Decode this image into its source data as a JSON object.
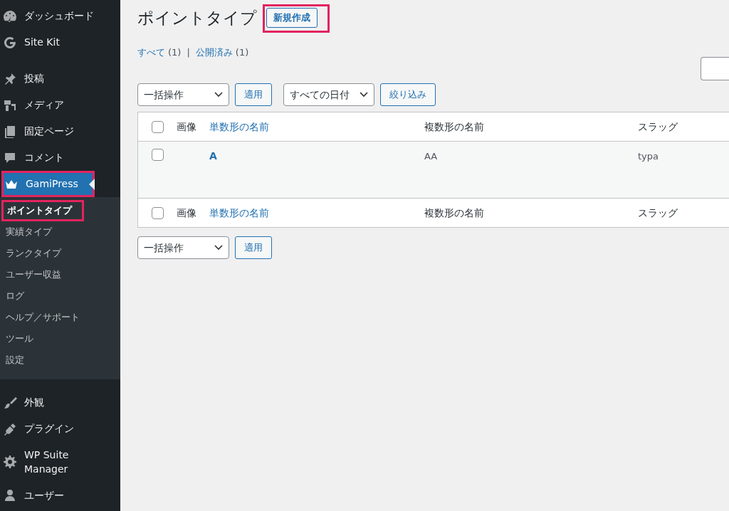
{
  "sidebar": {
    "groups": [
      [
        {
          "label": "ダッシュボード",
          "selected": false,
          "annotated": false
        },
        {
          "label": "Site Kit",
          "selected": false,
          "annotated": false
        }
      ],
      [
        {
          "label": "投稿",
          "selected": false,
          "annotated": false
        },
        {
          "label": "メディア",
          "selected": false,
          "annotated": false
        },
        {
          "label": "固定ページ",
          "selected": false,
          "annotated": false
        },
        {
          "label": "コメント",
          "selected": false,
          "annotated": false
        },
        {
          "label": "GamiPress",
          "selected": true,
          "annotated": true,
          "children": [
            {
              "label": "ポイントタイプ",
              "selected": true,
              "annotated": true
            },
            {
              "label": "実績タイプ",
              "selected": false,
              "annotated": false
            },
            {
              "label": "ランクタイプ",
              "selected": false,
              "annotated": false
            },
            {
              "label": "ユーザー収益",
              "selected": false,
              "annotated": false
            },
            {
              "label": "ログ",
              "selected": false,
              "annotated": false
            },
            {
              "label": "ヘルプ／サポート",
              "selected": false,
              "annotated": false
            },
            {
              "label": "ツール",
              "selected": false,
              "annotated": false
            },
            {
              "label": "設定",
              "selected": false,
              "annotated": false
            }
          ]
        }
      ],
      [
        {
          "label": "外観",
          "selected": false,
          "annotated": false
        },
        {
          "label": "プラグイン",
          "selected": false,
          "annotated": false
        },
        {
          "label": "WP Suite Manager",
          "selected": false,
          "annotated": false
        },
        {
          "label": "ユーザー",
          "selected": false,
          "annotated": false
        }
      ]
    ]
  },
  "page": {
    "title": "ポイントタイプ",
    "add_new": {
      "label": "新規作成",
      "annotated": true
    },
    "views": [
      {
        "label": "すべて",
        "count": "(1)"
      },
      {
        "label": "公開済み",
        "count": "(1)"
      }
    ],
    "separator": "|",
    "top_actions": {
      "bulk": "一括操作",
      "apply": "適用",
      "dates": "すべての日付",
      "filter": "絞り込み"
    },
    "table": {
      "header": {
        "checked": false,
        "columns": [
          {
            "label": "画像",
            "sortable": false
          },
          {
            "label": "単数形の名前",
            "sortable": true
          },
          {
            "label": "複数形の名前",
            "sortable": false
          },
          {
            "label": "スラッグ",
            "sortable": false
          }
        ]
      },
      "footer": {
        "checked": false,
        "columns": [
          {
            "label": "画像",
            "sortable": false
          },
          {
            "label": "単数形の名前",
            "sortable": true
          },
          {
            "label": "複数形の名前",
            "sortable": false
          },
          {
            "label": "スラッグ",
            "sortable": false
          }
        ]
      },
      "rows": [
        {
          "checked": false,
          "name": "A",
          "plural": "AA",
          "slug": "typa"
        }
      ]
    },
    "bottom_actions": {
      "bulk": "一括操作",
      "apply": "適用"
    }
  }
}
